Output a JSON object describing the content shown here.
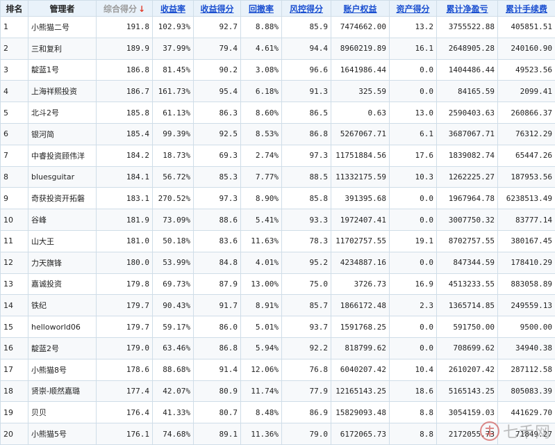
{
  "headers": {
    "rank": "排名",
    "manager": "管理者",
    "total_score": "综合得分",
    "sort_arrow": "↓",
    "return_rate": "收益率",
    "return_score": "收益得分",
    "drawdown": "回撤率",
    "risk_score": "风控得分",
    "equity": "账户权益",
    "asset_score": "资产得分",
    "net_pnl": "累计净盈亏",
    "fees": "累计手续费"
  },
  "rows": [
    {
      "rank": "1",
      "manager": "小熊猫二号",
      "total": "191.8",
      "ret": "102.93%",
      "ret_score": "92.7",
      "dd": "8.88%",
      "risk": "85.9",
      "equity": "7474662.00",
      "asset": "13.2",
      "pnl": "3755522.88",
      "fee": "405851.51"
    },
    {
      "rank": "2",
      "manager": "三和复利",
      "total": "189.9",
      "ret": "37.99%",
      "ret_score": "79.4",
      "dd": "4.61%",
      "risk": "94.4",
      "equity": "8960219.89",
      "asset": "16.1",
      "pnl": "2648905.28",
      "fee": "240160.90"
    },
    {
      "rank": "3",
      "manager": "靛蓝1号",
      "total": "186.8",
      "ret": "81.45%",
      "ret_score": "90.2",
      "dd": "3.08%",
      "risk": "96.6",
      "equity": "1641986.44",
      "asset": "0.0",
      "pnl": "1404486.44",
      "fee": "49523.56"
    },
    {
      "rank": "4",
      "manager": "上海祥熙投资",
      "total": "186.7",
      "ret": "161.73%",
      "ret_score": "95.4",
      "dd": "6.18%",
      "risk": "91.3",
      "equity": "325.59",
      "asset": "0.0",
      "pnl": "84165.59",
      "fee": "2099.41"
    },
    {
      "rank": "5",
      "manager": "北斗2号",
      "total": "185.8",
      "ret": "61.13%",
      "ret_score": "86.3",
      "dd": "8.60%",
      "risk": "86.5",
      "equity": "0.63",
      "asset": "13.0",
      "pnl": "2590403.63",
      "fee": "260866.37"
    },
    {
      "rank": "6",
      "manager": "银河简",
      "total": "185.4",
      "ret": "99.39%",
      "ret_score": "92.5",
      "dd": "8.53%",
      "risk": "86.8",
      "equity": "5267067.71",
      "asset": "6.1",
      "pnl": "3687067.71",
      "fee": "76312.29"
    },
    {
      "rank": "7",
      "manager": "中睿投资顾伟洋",
      "total": "184.2",
      "ret": "18.73%",
      "ret_score": "69.3",
      "dd": "2.74%",
      "risk": "97.3",
      "equity": "11751884.56",
      "asset": "17.6",
      "pnl": "1839082.74",
      "fee": "65447.26"
    },
    {
      "rank": "8",
      "manager": "bluesguitar",
      "total": "184.1",
      "ret": "56.72%",
      "ret_score": "85.3",
      "dd": "7.77%",
      "risk": "88.5",
      "equity": "11332175.59",
      "asset": "10.3",
      "pnl": "1262225.27",
      "fee": "187953.56"
    },
    {
      "rank": "9",
      "manager": "奇获投资开拓磐",
      "total": "183.1",
      "ret": "270.52%",
      "ret_score": "97.3",
      "dd": "8.90%",
      "risk": "85.8",
      "equity": "391395.68",
      "asset": "0.0",
      "pnl": "1967964.78",
      "fee": "6238513.49"
    },
    {
      "rank": "10",
      "manager": "谷峰",
      "total": "181.9",
      "ret": "73.09%",
      "ret_score": "88.6",
      "dd": "5.41%",
      "risk": "93.3",
      "equity": "1972407.41",
      "asset": "0.0",
      "pnl": "3007750.32",
      "fee": "83777.14"
    },
    {
      "rank": "11",
      "manager": "山大王",
      "total": "181.0",
      "ret": "50.18%",
      "ret_score": "83.6",
      "dd": "11.63%",
      "risk": "78.3",
      "equity": "11702757.55",
      "asset": "19.1",
      "pnl": "8702757.55",
      "fee": "380167.45"
    },
    {
      "rank": "12",
      "manager": "力天旗锋",
      "total": "180.0",
      "ret": "53.99%",
      "ret_score": "84.8",
      "dd": "4.01%",
      "risk": "95.2",
      "equity": "4234887.16",
      "asset": "0.0",
      "pnl": "847344.59",
      "fee": "178410.29"
    },
    {
      "rank": "13",
      "manager": "嘉诚投资",
      "total": "179.8",
      "ret": "69.73%",
      "ret_score": "87.9",
      "dd": "13.00%",
      "risk": "75.0",
      "equity": "3726.73",
      "asset": "16.9",
      "pnl": "4513233.55",
      "fee": "883058.89"
    },
    {
      "rank": "14",
      "manager": "铁纪",
      "total": "179.7",
      "ret": "90.43%",
      "ret_score": "91.7",
      "dd": "8.91%",
      "risk": "85.7",
      "equity": "1866172.48",
      "asset": "2.3",
      "pnl": "1365714.85",
      "fee": "249559.13"
    },
    {
      "rank": "15",
      "manager": "helloworld06",
      "total": "179.7",
      "ret": "59.17%",
      "ret_score": "86.0",
      "dd": "5.01%",
      "risk": "93.7",
      "equity": "1591768.25",
      "asset": "0.0",
      "pnl": "591750.00",
      "fee": "9500.00"
    },
    {
      "rank": "16",
      "manager": "靛蓝2号",
      "total": "179.0",
      "ret": "63.46%",
      "ret_score": "86.8",
      "dd": "5.94%",
      "risk": "92.2",
      "equity": "818799.62",
      "asset": "0.0",
      "pnl": "708699.62",
      "fee": "34940.38"
    },
    {
      "rank": "17",
      "manager": "小熊猫8号",
      "total": "178.6",
      "ret": "88.68%",
      "ret_score": "91.4",
      "dd": "12.06%",
      "risk": "76.8",
      "equity": "6040207.42",
      "asset": "10.4",
      "pnl": "2610207.42",
      "fee": "287112.58"
    },
    {
      "rank": "18",
      "manager": "贤崇-顺然嘉璐",
      "total": "177.4",
      "ret": "42.07%",
      "ret_score": "80.9",
      "dd": "11.74%",
      "risk": "77.9",
      "equity": "12165143.25",
      "asset": "18.6",
      "pnl": "5165143.25",
      "fee": "805083.39"
    },
    {
      "rank": "19",
      "manager": "贝贝",
      "total": "176.4",
      "ret": "41.33%",
      "ret_score": "80.7",
      "dd": "8.48%",
      "risk": "86.9",
      "equity": "15829093.48",
      "asset": "8.8",
      "pnl": "3054159.03",
      "fee": "441629.70"
    },
    {
      "rank": "20",
      "manager": "小熊猫5号",
      "total": "176.1",
      "ret": "74.68%",
      "ret_score": "89.1",
      "dd": "11.36%",
      "risk": "79.0",
      "equity": "6172065.73",
      "asset": "8.8",
      "pnl": "2172055.73",
      "fee": "71849.27"
    }
  ],
  "watermark": "七禾网",
  "colors": {
    "header_bg": "#e9f2fa",
    "link": "#1a4fd0",
    "pnl_red": "#d42020",
    "border": "#cfdde8",
    "arrow": "#e23b2b"
  }
}
